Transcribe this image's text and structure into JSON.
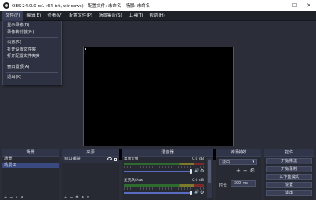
{
  "window": {
    "title": "OBS 24.0.0-rc1 (64-bit, windows) - 配置文件: 未命名 - 场景: 未命名",
    "minimize": "—",
    "maximize": "☐",
    "close": "✕"
  },
  "menu": {
    "items": [
      "文件(F)",
      "编辑(E)",
      "查看(V)",
      "配置文件(P)",
      "场景集合(S)",
      "工具(T)",
      "帮助(H)"
    ]
  },
  "file_menu": {
    "items": [
      "显示录像(R)",
      "录像转封装(M)",
      "设置(S)",
      "打开设置文件夹",
      "打开配置文件夹夹",
      "窗口置顶(A)",
      "退出(X)"
    ]
  },
  "docks": {
    "scenes": {
      "title": "场景",
      "items": [
        "场景",
        "场景 2"
      ],
      "toolbar": [
        "+",
        "−",
        "∧",
        "∨"
      ]
    },
    "sources": {
      "title": "来源",
      "items": [
        "窗口捕获"
      ],
      "toolbar": [
        "+",
        "−",
        "⚙",
        "∧",
        "∨"
      ]
    },
    "mixer": {
      "title": "混音器",
      "channels": [
        {
          "name": "桌面音频",
          "db": "0.0 dB"
        },
        {
          "name": "麦克风/Aux",
          "db": "0.0 dB"
        }
      ]
    },
    "transitions": {
      "title": "转场特效",
      "selected": "淡出",
      "add": "+",
      "remove": "−",
      "gear": "⚙",
      "duration_label": "时长",
      "duration_value": "300 ms"
    },
    "controls": {
      "title": "控件",
      "buttons": [
        "开始推流",
        "开始录制",
        "工作室模式",
        "设置",
        "退出"
      ]
    }
  }
}
